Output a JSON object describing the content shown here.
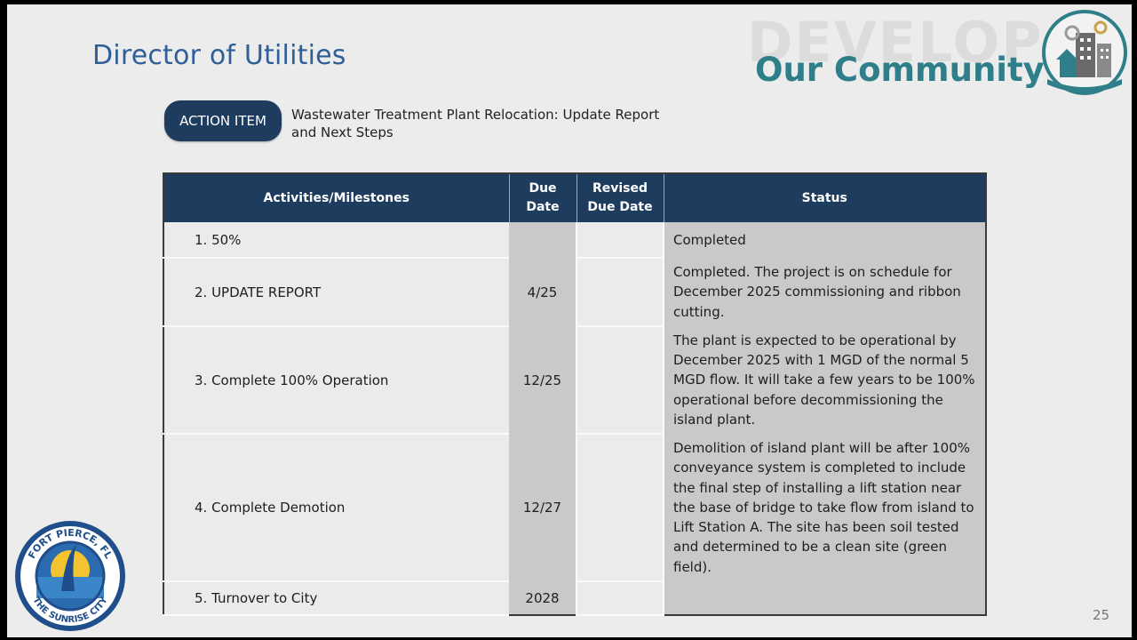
{
  "slide": {
    "title": "Director of Utilities",
    "brand": {
      "develop": "DEVELOP",
      "community": "Our Community"
    },
    "action_item": {
      "badge": "ACTION ITEM",
      "text": "Wastewater Treatment Plant Relocation: Update Report and Next Steps"
    },
    "table": {
      "headers": {
        "activities": "Activities/Milestones",
        "due_line1": "Due",
        "due_line2": "Date",
        "revised_line1": "Revised",
        "revised_line2": "Due Date",
        "status": "Status"
      },
      "rows": [
        {
          "activity": "1.  50%",
          "due": "",
          "revised": "",
          "status": "Completed"
        },
        {
          "activity": "2.  UPDATE REPORT",
          "due": "4/25",
          "revised": "",
          "status": "Completed. The project is on schedule for December 2025 commissioning and ribbon cutting."
        },
        {
          "activity": "3.  Complete 100% Operation",
          "due": "12/25",
          "revised": "",
          "status": "The plant is expected to be operational by December 2025 with 1 MGD of the normal 5 MGD flow. It will take a few years to be 100% operational before decommissioning the island plant."
        },
        {
          "activity": "4.  Complete Demotion",
          "due": "12/27",
          "revised": "",
          "status": "Demolition of island plant will be after 100% conveyance system is completed to include the final step of installing a lift station near the base of bridge to take flow from island to Lift Station A. The site has been soil tested and determined to be a clean site (green field)."
        },
        {
          "activity": "5.  Turnover to City",
          "due": "2028",
          "revised": "",
          "status": ""
        }
      ]
    },
    "page_number": "25",
    "seal": {
      "top_text": "FORT PIERCE, FL",
      "bottom_text": "THE SUNRISE CITY"
    },
    "colors": {
      "title": "#2f5f98",
      "header_bg": "#1e3d5e",
      "brand_teal": "#2f7f8a"
    }
  }
}
